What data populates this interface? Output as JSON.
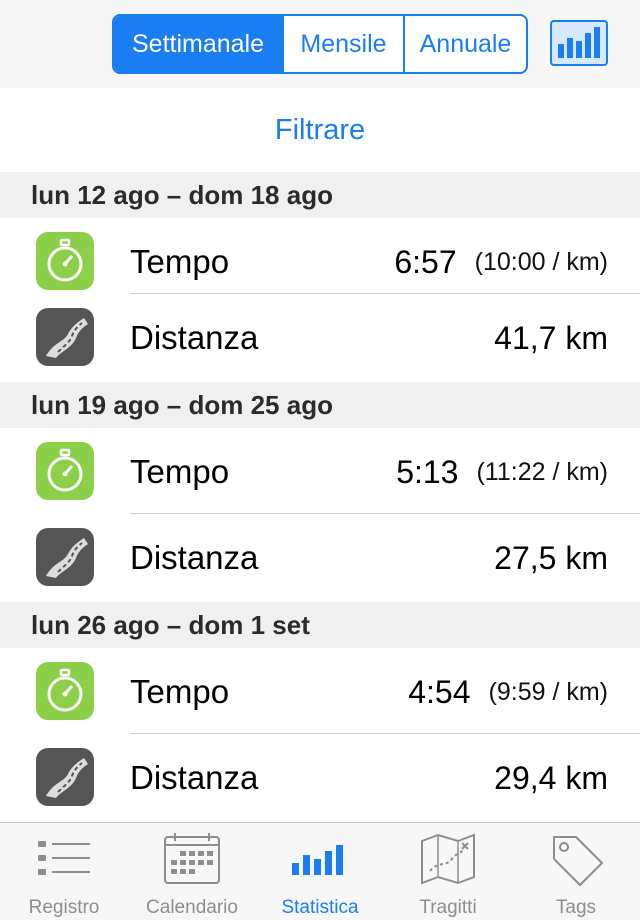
{
  "periods": {
    "weekly": "Settimanale",
    "monthly": "Mensile",
    "yearly": "Annuale",
    "selected": "Settimanale"
  },
  "filter_label": "Filtrare",
  "weeks": [
    {
      "header": "lun 12 ago – dom 18 ago",
      "time_label": "Tempo",
      "time_value": "6:57",
      "pace": "(10:00 / km)",
      "distance_label": "Distanza",
      "distance_value": "41,7 km"
    },
    {
      "header": "lun 19 ago – dom 25 ago",
      "time_label": "Tempo",
      "time_value": "5:13",
      "pace": "(11:22 / km)",
      "distance_label": "Distanza",
      "distance_value": "27,5 km"
    },
    {
      "header": "lun 26 ago – dom 1 set",
      "time_label": "Tempo",
      "time_value": "4:54",
      "pace": "(9:59 / km)",
      "distance_label": "Distanza",
      "distance_value": "29,4 km"
    }
  ],
  "tabs": [
    {
      "label": "Registro",
      "icon": "list-icon"
    },
    {
      "label": "Calendario",
      "icon": "calendar-icon"
    },
    {
      "label": "Statistica",
      "icon": "bar-chart-icon"
    },
    {
      "label": "Tragitti",
      "icon": "map-icon"
    },
    {
      "label": "Tags",
      "icon": "tag-icon"
    }
  ],
  "active_tab": "Statistica",
  "colors": {
    "accent": "#1a7ef2",
    "time_icon": "#8cd04a",
    "distance_icon": "#555555",
    "inactive_tab": "#8e8e8e"
  }
}
